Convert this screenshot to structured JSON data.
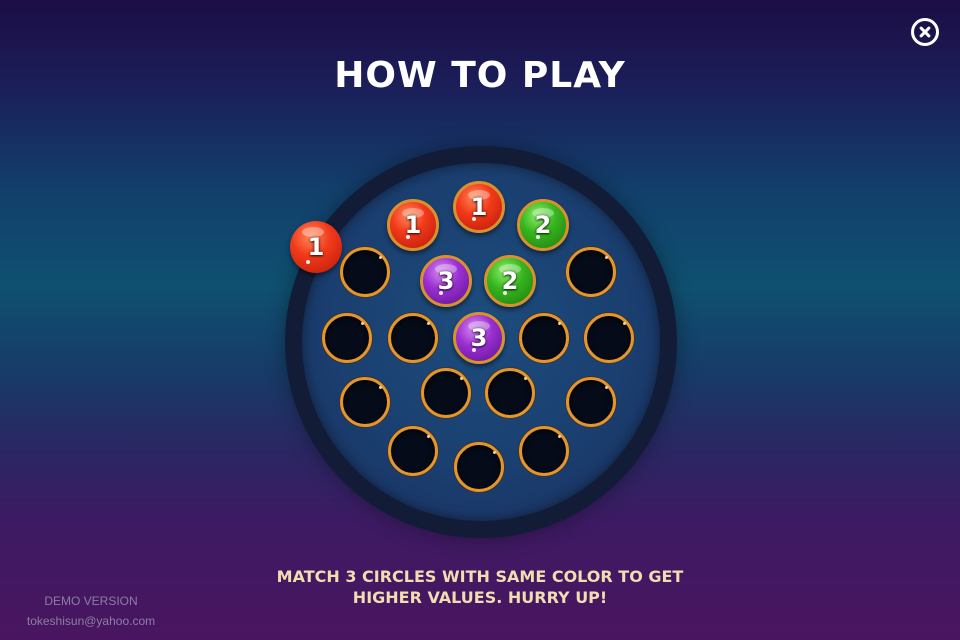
{
  "title": "HOW TO PLAY",
  "close_icon": "close-circle-icon",
  "balls": [
    {
      "number": "1",
      "color": "red"
    },
    {
      "number": "1",
      "color": "red"
    },
    {
      "number": "1",
      "color": "red"
    },
    {
      "number": "2",
      "color": "green"
    },
    {
      "number": "3",
      "color": "purple"
    },
    {
      "number": "2",
      "color": "green"
    },
    {
      "number": "3",
      "color": "purple"
    }
  ],
  "instruction_line1": "MATCH 3 CIRCLES WITH SAME COLOR TO GET",
  "instruction_line2": "HIGHER VALUES. HURRY UP!",
  "footer": {
    "demo_label": "DEMO VERSION",
    "email": "tokeshisun@yahoo.com"
  },
  "colors": {
    "red": "#f23a1a",
    "green": "#36b51e",
    "purple": "#9a2fd1",
    "slot_rim": "#e4962a",
    "instruction_text": "#f2ddb0"
  }
}
